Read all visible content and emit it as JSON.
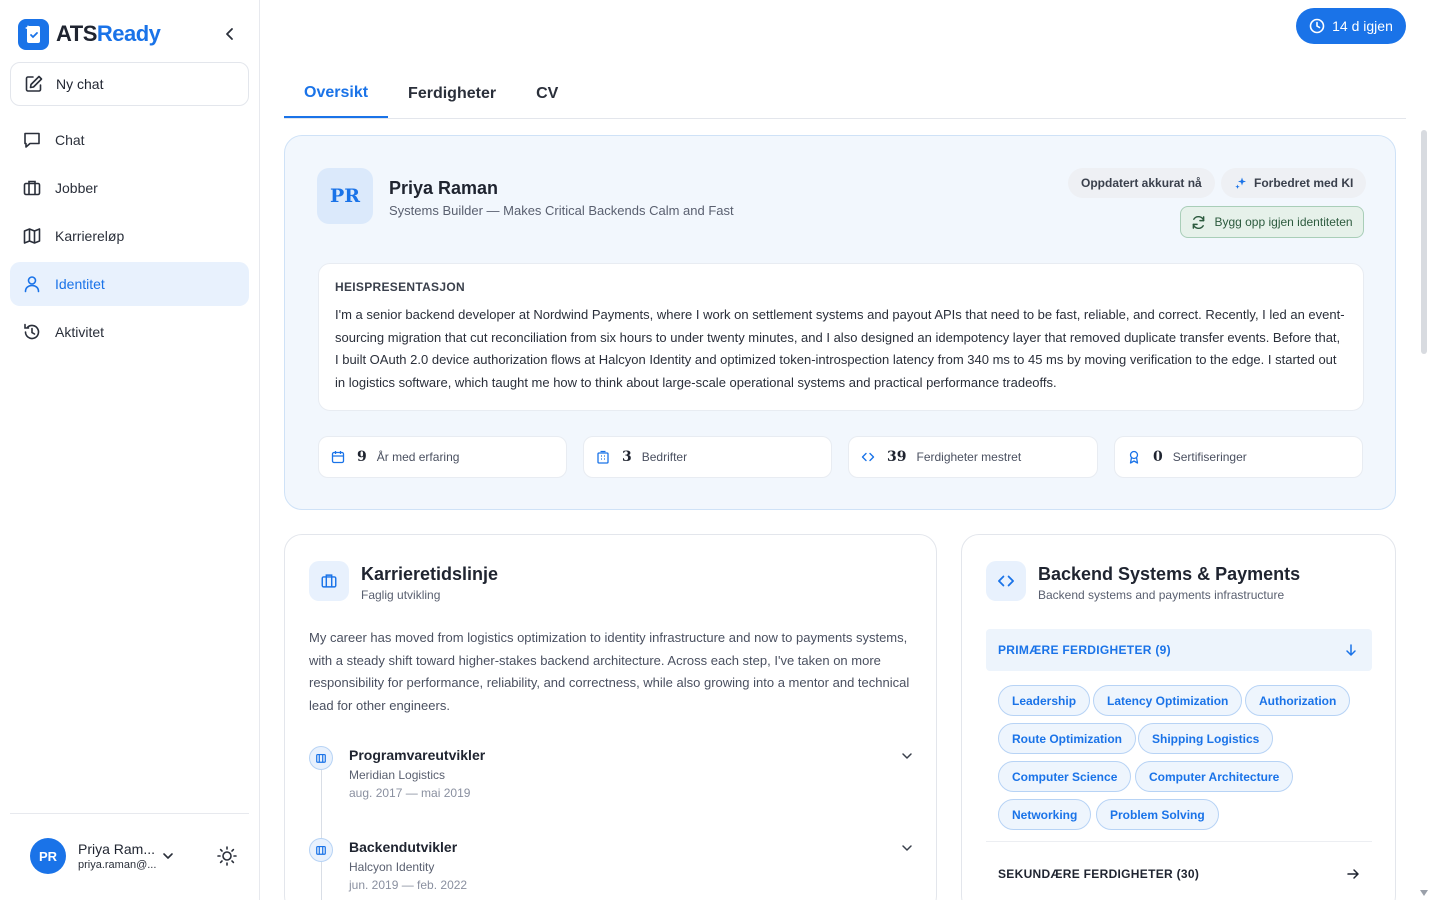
{
  "brand": {
    "name_part1": "ATS",
    "name_part2": "Ready",
    "brand_color": "#1a73e8"
  },
  "sidebar": {
    "new_chat_label": "Ny chat",
    "items": [
      {
        "label": "Chat",
        "icon": "chat-bubble-icon",
        "active": false
      },
      {
        "label": "Jobber",
        "icon": "briefcase-icon",
        "active": false
      },
      {
        "label": "Karriereløp",
        "icon": "map-icon",
        "active": false
      },
      {
        "label": "Identitet",
        "icon": "user-icon",
        "active": true
      },
      {
        "label": "Aktivitet",
        "icon": "history-icon",
        "active": false
      }
    ],
    "user": {
      "initials": "PR",
      "name": "Priya Ram...",
      "email": "priya.raman@..."
    }
  },
  "header": {
    "trial_label": "14 d igjen"
  },
  "tabs": [
    {
      "label": "Oversikt",
      "active": true
    },
    {
      "label": "Ferdigheter",
      "active": false
    },
    {
      "label": "CV",
      "active": false
    }
  ],
  "profile": {
    "initials": "PR",
    "name": "Priya Raman",
    "headline": "Systems Builder — Makes Critical Backends Calm and Fast",
    "updated_label": "Oppdatert akkurat nå",
    "ai_label": "Forbedret med KI",
    "rebuild_label": "Bygg opp igjen identiteten",
    "pitch_title": "HEISPRESENTASJON",
    "pitch_text": "I'm a senior backend developer at Nordwind Payments, where I work on settlement systems and payout APIs that need to be fast, reliable, and correct. Recently, I led an event-sourcing migration that cut reconciliation from six hours to under twenty minutes, and I also designed an idempotency layer that removed duplicate transfer events. Before that, I built OAuth 2.0 device authorization flows at Halcyon Identity and optimized token-introspection latency from 340 ms to 45 ms by moving verification to the edge. I started out in logistics software, which taught me how to think about large-scale operational systems and practical performance tradeoffs.",
    "stats": [
      {
        "value": "9",
        "label": "År med erfaring",
        "icon": "calendar-icon"
      },
      {
        "value": "3",
        "label": "Bedrifter",
        "icon": "building-icon"
      },
      {
        "value": "39",
        "label": "Ferdigheter mestret",
        "icon": "code-icon"
      },
      {
        "value": "0",
        "label": "Sertifiseringer",
        "icon": "award-icon"
      }
    ]
  },
  "career": {
    "title": "Karrieretidslinje",
    "subtitle": "Faglig utvikling",
    "summary": "My career has moved from logistics optimization to identity infrastructure and now to payments systems, with a steady shift toward higher-stakes backend architecture. Across each step, I've taken on more responsibility for performance, reliability, and correctness, while also growing into a mentor and technical lead for other engineers.",
    "items": [
      {
        "role": "Programvareutvikler",
        "company": "Meridian Logistics",
        "dates": "aug. 2017 — mai 2019"
      },
      {
        "role": "Backendutvikler",
        "company": "Halcyon Identity",
        "dates": "jun. 2019 — feb. 2022"
      }
    ]
  },
  "skills": {
    "title": "Backend Systems & Payments",
    "subtitle": "Backend systems and payments infrastructure",
    "primary_label": "PRIMÆRE FERDIGHETER (9)",
    "primary": [
      "Leadership",
      "Latency Optimization",
      "Authorization",
      "Route Optimization",
      "Shipping Logistics",
      "Computer Science",
      "Computer Architecture",
      "Networking",
      "Problem Solving"
    ],
    "secondary_label": "SEKUNDÆRE FERDIGHETER (30)"
  }
}
